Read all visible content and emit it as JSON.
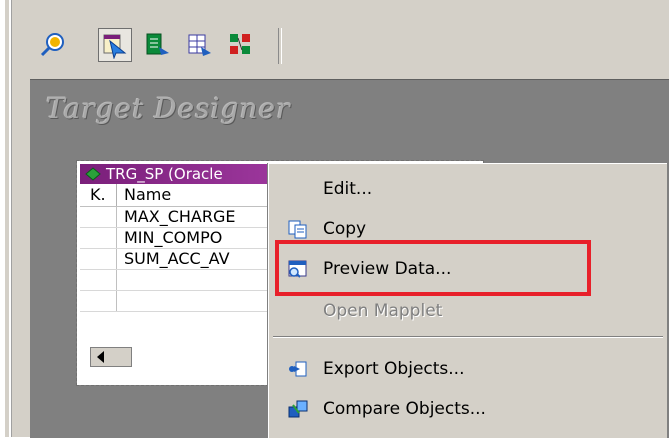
{
  "workspace": {
    "title": "Target Designer"
  },
  "toolbar": {
    "buttons": [
      {
        "name": "source-analyzer",
        "icon": "magnifier-globe-icon"
      },
      {
        "name": "target-designer",
        "icon": "target-designer-icon",
        "active": true
      },
      {
        "name": "transformation-developer",
        "icon": "transformation-icon"
      },
      {
        "name": "mapplet-designer",
        "icon": "mapplet-icon"
      },
      {
        "name": "mapping-designer",
        "icon": "mapping-icon"
      }
    ]
  },
  "target_table": {
    "title": "TRG_SP (Oracle",
    "columns": {
      "key": "K.",
      "name": "Name"
    },
    "rows": [
      "MAX_CHARGE",
      "MIN_COMPO",
      "SUM_ACC_AV"
    ]
  },
  "context_menu": {
    "edit": "Edit...",
    "copy": "Copy",
    "preview_data": "Preview Data...",
    "open_mapplet": "Open Mapplet",
    "export_objects": "Export Objects...",
    "compare_objects": "Compare Objects..."
  },
  "colors": {
    "highlight": "#e8202a",
    "header": "#a43ca4",
    "menu_bg": "#d4d0c8"
  }
}
